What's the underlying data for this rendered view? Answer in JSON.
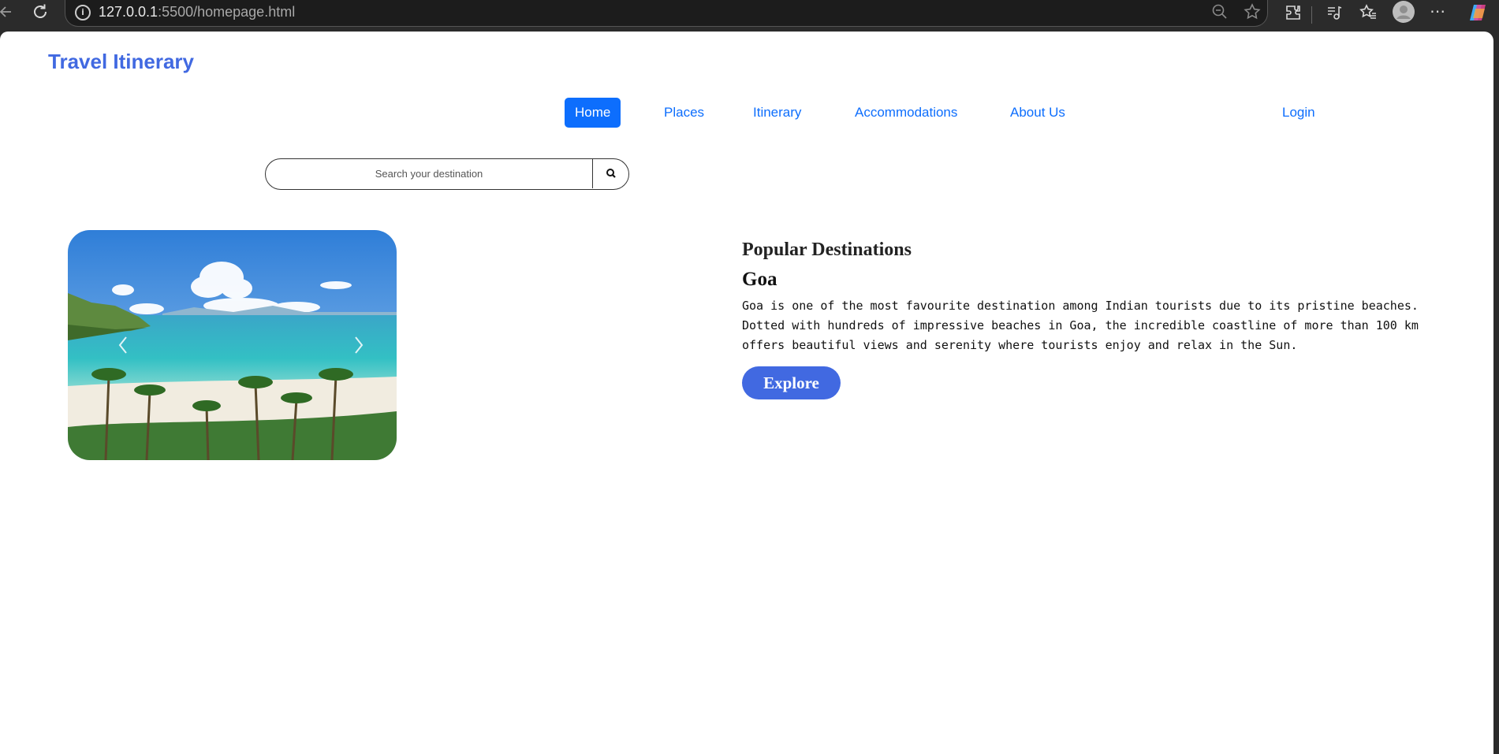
{
  "browser": {
    "url_host": "127.0.0.1",
    "url_rest": ":5500/homepage.html"
  },
  "brand": {
    "title": "Travel Itinerary"
  },
  "nav": {
    "items": [
      {
        "label": "Home"
      },
      {
        "label": "Places"
      },
      {
        "label": "Itinerary"
      },
      {
        "label": "Accommodations"
      },
      {
        "label": "About Us"
      }
    ],
    "login": "Login"
  },
  "search": {
    "placeholder": "Search your destination"
  },
  "featured": {
    "heading": "Popular Destinations",
    "destination": "Goa",
    "description": "Goa is one of the most favourite destination among Indian tourists due to its pristine beaches. Dotted with hundreds of impressive beaches in Goa, the incredible coastline of more than 100 km offers beautiful views and serenity where tourists enjoy and relax in the Sun.",
    "button": "Explore"
  },
  "colors": {
    "brand": "#4169e1",
    "nav_active": "#0d6efd",
    "explore": "#4169e1"
  },
  "icons": [
    "back-icon",
    "reload-icon",
    "info-icon",
    "zoom-out-icon",
    "star-icon",
    "extensions-icon",
    "media-icon",
    "favorites-icon",
    "profile-icon",
    "more-icon",
    "copilot-icon",
    "search-icon",
    "chevron-left-icon",
    "chevron-right-icon"
  ]
}
